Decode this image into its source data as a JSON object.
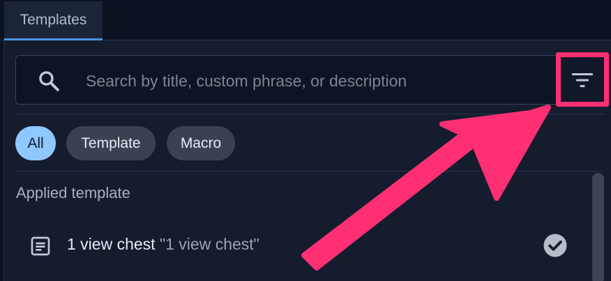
{
  "tabs": [
    {
      "label": "Templates",
      "active": true
    }
  ],
  "search": {
    "placeholder": "Search by title, custom phrase, or description",
    "value": ""
  },
  "filter_button": {
    "icon": "filter-icon",
    "highlighted": true
  },
  "chips": [
    {
      "label": "All",
      "selected": true
    },
    {
      "label": "Template",
      "selected": false
    },
    {
      "label": "Macro",
      "selected": false
    }
  ],
  "applied_section": {
    "label": "Applied template",
    "items": [
      {
        "title": "1 view chest",
        "phrase": "\"1 view chest\"",
        "icon": "document-icon",
        "status_icon": "check-circle-icon",
        "applied": true
      }
    ]
  },
  "colors": {
    "background": "#0b1220",
    "panel": "#141c2e",
    "accent": "#4d96e0",
    "chip_selected": "#8fc8ff",
    "chip_default": "#3a4252",
    "annotation": "#ff2f74"
  }
}
